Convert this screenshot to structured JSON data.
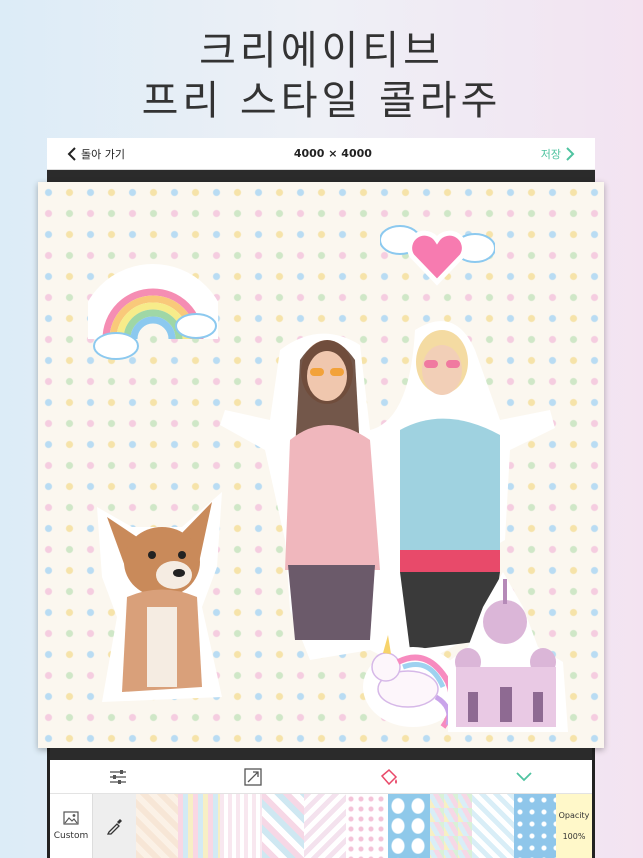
{
  "headline": {
    "line1": "크리에이티브",
    "line2": "프리 스타일 콜라주"
  },
  "topbar": {
    "back_label": "돌아 가기",
    "dimensions": "4000 × 4000",
    "save_label": "저장"
  },
  "toolbar": {
    "tools": [
      "adjust-sliders",
      "resize",
      "eraser-bucket",
      "collapse-chevron"
    ],
    "active_color": "#e94a6a",
    "accent": "#4fc3a0"
  },
  "swatches": {
    "custom_label": "Custom",
    "opacity_label": "Opacity",
    "opacity_value": "100%",
    "items": [
      "#f7e6d6",
      "#f9d7e4",
      "#cfe8f2",
      "#f6d8e6",
      "#e8f4fa",
      "#f4e2ee",
      "#8fc9ea",
      "#f7f0c4",
      "#d9eef7",
      "#8fc6ea"
    ]
  }
}
